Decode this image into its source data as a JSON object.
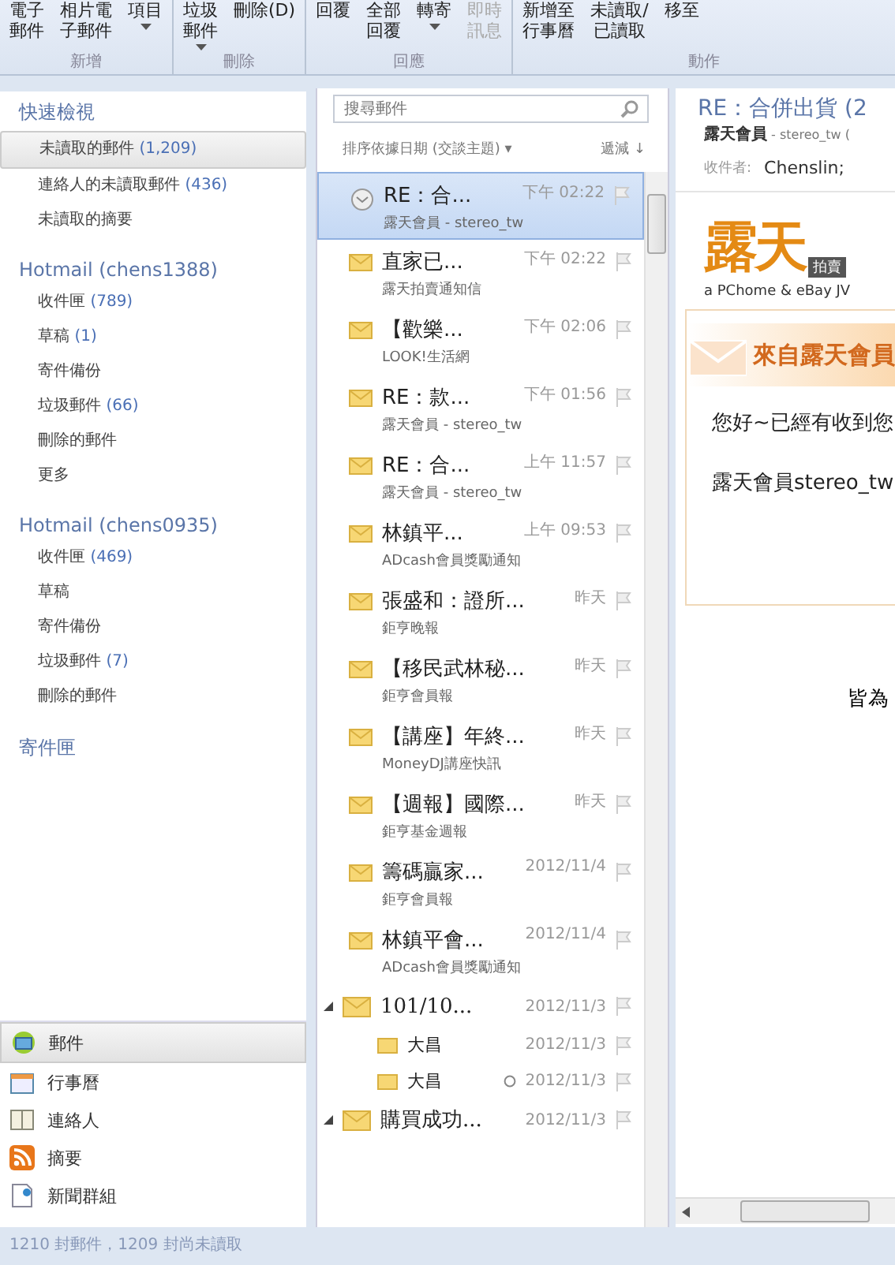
{
  "ribbon": {
    "groups": [
      {
        "label": "新增",
        "buttons": [
          {
            "lines": [
              "電子",
              "郵件"
            ],
            "dropdown": false,
            "disabled": false
          },
          {
            "lines": [
              "相片電",
              "子郵件"
            ],
            "dropdown": false,
            "disabled": false
          },
          {
            "lines": [
              "項目"
            ],
            "dropdown": true,
            "disabled": false
          }
        ]
      },
      {
        "label": "刪除",
        "buttons": [
          {
            "lines": [
              "垃圾",
              "郵件"
            ],
            "dropdown": true,
            "disabled": false
          },
          {
            "lines": [
              "刪除(D)"
            ],
            "dropdown": false,
            "disabled": false
          }
        ]
      },
      {
        "label": "回應",
        "buttons": [
          {
            "lines": [
              "回覆"
            ],
            "dropdown": false,
            "disabled": false
          },
          {
            "lines": [
              "全部",
              "回覆"
            ],
            "dropdown": false,
            "disabled": false
          },
          {
            "lines": [
              "轉寄"
            ],
            "dropdown": true,
            "disabled": false
          },
          {
            "lines": [
              "即時",
              "訊息"
            ],
            "dropdown": false,
            "disabled": true
          }
        ]
      },
      {
        "label": "動作",
        "buttons": [
          {
            "lines": [
              "新增至",
              "行事曆"
            ],
            "dropdown": false,
            "disabled": false
          },
          {
            "lines": [
              "未讀取/",
              "已讀取"
            ],
            "dropdown": false,
            "disabled": false
          },
          {
            "lines": [
              "移至"
            ],
            "dropdown": false,
            "disabled": false
          }
        ]
      }
    ]
  },
  "sidebar": {
    "sections": [
      {
        "title": "快速檢視",
        "items": [
          {
            "label": "未讀取的郵件",
            "count": "(1,209)",
            "selected": true
          },
          {
            "label": "連絡人的未讀取郵件",
            "count": "(436)",
            "selected": false
          },
          {
            "label": "未讀取的摘要",
            "selected": false
          }
        ]
      },
      {
        "title": "Hotmail (chens1388)",
        "items": [
          {
            "label": "收件匣",
            "count": "(789)",
            "selected": false
          },
          {
            "label": "草稿",
            "count": "(1)",
            "selected": false
          },
          {
            "label": "寄件備份",
            "selected": false
          },
          {
            "label": "垃圾郵件",
            "count": "(66)",
            "selected": false
          },
          {
            "label": "刪除的郵件",
            "selected": false
          },
          {
            "label": "更多",
            "selected": false
          }
        ]
      },
      {
        "title": "Hotmail (chens0935)",
        "items": [
          {
            "label": "收件匣",
            "count": "(469)",
            "selected": false
          },
          {
            "label": "草稿",
            "selected": false
          },
          {
            "label": "寄件備份",
            "selected": false
          },
          {
            "label": "垃圾郵件",
            "count": "(7)",
            "selected": false
          },
          {
            "label": "刪除的郵件",
            "selected": false
          }
        ]
      },
      {
        "title": "寄件匣"
      }
    ],
    "nav": [
      {
        "kind": "mail",
        "label": "郵件",
        "selected": true
      },
      {
        "kind": "calendar",
        "label": "行事曆",
        "selected": false
      },
      {
        "kind": "contacts",
        "label": "連絡人",
        "selected": false
      },
      {
        "kind": "feeds",
        "label": "摘要",
        "selected": false
      },
      {
        "kind": "newsgroups",
        "label": "新聞群組",
        "selected": false
      }
    ]
  },
  "message_list": {
    "search": {
      "placeholder": "搜尋郵件"
    },
    "sort": {
      "label": "排序依據日期 (交談主題) ▾",
      "order": "遞減 ↓"
    },
    "messages": [
      {
        "kind": "message",
        "subject": "RE：合...",
        "sender": "露天會員 - stereo_tw",
        "time": "下午 02:22",
        "read": true,
        "selected": true
      },
      {
        "kind": "message",
        "subject": "直家已...",
        "sender": "露天拍賣通知信",
        "time": "下午 02:22",
        "read": false,
        "selected": false
      },
      {
        "kind": "message",
        "subject": "【歡樂...",
        "sender": "LOOK!生活網",
        "time": "下午 02:06",
        "read": false,
        "selected": false
      },
      {
        "kind": "message",
        "subject": "RE：款...",
        "sender": "露天會員 - stereo_tw",
        "time": "下午 01:56",
        "read": false,
        "selected": false
      },
      {
        "kind": "message",
        "subject": "RE：合...",
        "sender": "露天會員 - stereo_tw",
        "time": "上午 11:57",
        "read": false,
        "selected": false
      },
      {
        "kind": "message",
        "subject": "林鎮平...",
        "sender": "ADcash會員獎勵通知",
        "time": "上午 09:53",
        "read": false,
        "selected": false
      },
      {
        "kind": "message",
        "subject": "張盛和：證所...",
        "sender": "鉅亨晚報",
        "time": "昨天",
        "read": false,
        "selected": false
      },
      {
        "kind": "message",
        "subject": "【移民武林秘...",
        "sender": "鉅亨會員報",
        "time": "昨天",
        "read": false,
        "selected": false
      },
      {
        "kind": "message",
        "subject": "【講座】年終...",
        "sender": "MoneyDJ講座快訊",
        "time": "昨天",
        "read": false,
        "selected": false
      },
      {
        "kind": "message",
        "subject": "【週報】國際...",
        "sender": "鉅亨基金週報",
        "time": "昨天",
        "read": false,
        "selected": false
      },
      {
        "kind": "message",
        "subject": "籌碼贏家...",
        "sender": "鉅亨會員報",
        "time": "2012/11/4",
        "read": false,
        "selected": false
      },
      {
        "kind": "message",
        "subject": "林鎮平會...",
        "sender": "ADcash會員獎勵通知",
        "time": "2012/11/4",
        "read": false,
        "selected": false
      },
      {
        "kind": "thread",
        "subject": "101/10...",
        "time": "2012/11/3",
        "read": false,
        "selected": false,
        "expanded": true,
        "children": [
          {
            "kind": "child",
            "subject": "大昌",
            "time": "2012/11/3",
            "read": false,
            "selected": false,
            "attachment": false
          },
          {
            "kind": "child",
            "subject": "大昌",
            "time": "2012/11/3",
            "read": false,
            "selected": false,
            "attachment": true
          }
        ]
      },
      {
        "kind": "thread",
        "subject": "購買成功...",
        "time": "2012/11/3",
        "read": false,
        "selected": false,
        "expanded": true
      }
    ]
  },
  "reading_pane": {
    "subject": "RE：合併出貨 (2",
    "sender": "露天會員",
    "sender_detail": " - stereo_tw (",
    "to_label": "收件者:",
    "to": "Chenslin;",
    "logo": {
      "big": "露天",
      "badge": "拍賣",
      "tagline": "a PChome & eBay JV"
    },
    "banner": "來自露天會員",
    "paragraphs": [
      "您好~已經有收到您",
      "露天會員stereo_tw"
    ],
    "footer": "皆為"
  },
  "status_bar": "1210 封郵件，1209 封尚未讀取"
}
